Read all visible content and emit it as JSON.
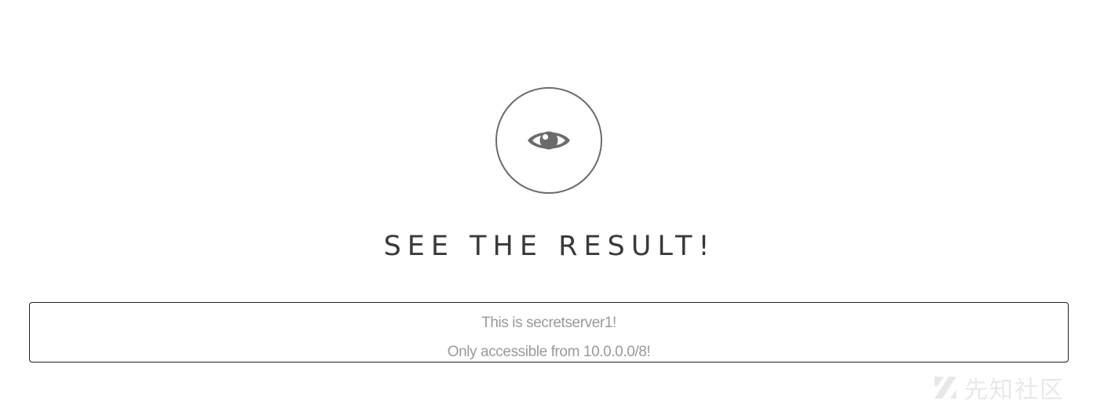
{
  "hero": {
    "icon": "eye-icon",
    "title": "SEE THE RESULT!"
  },
  "result": {
    "lines": [
      "This is secretserver1!",
      "Only accessible from 10.0.0.0/8!"
    ]
  },
  "watermark": {
    "text": "先知社区"
  },
  "colors": {
    "icon_stroke": "#6b6b6b",
    "heading": "#3a3a3a",
    "result_text": "#9a9a9a",
    "box_border": "#222222"
  }
}
